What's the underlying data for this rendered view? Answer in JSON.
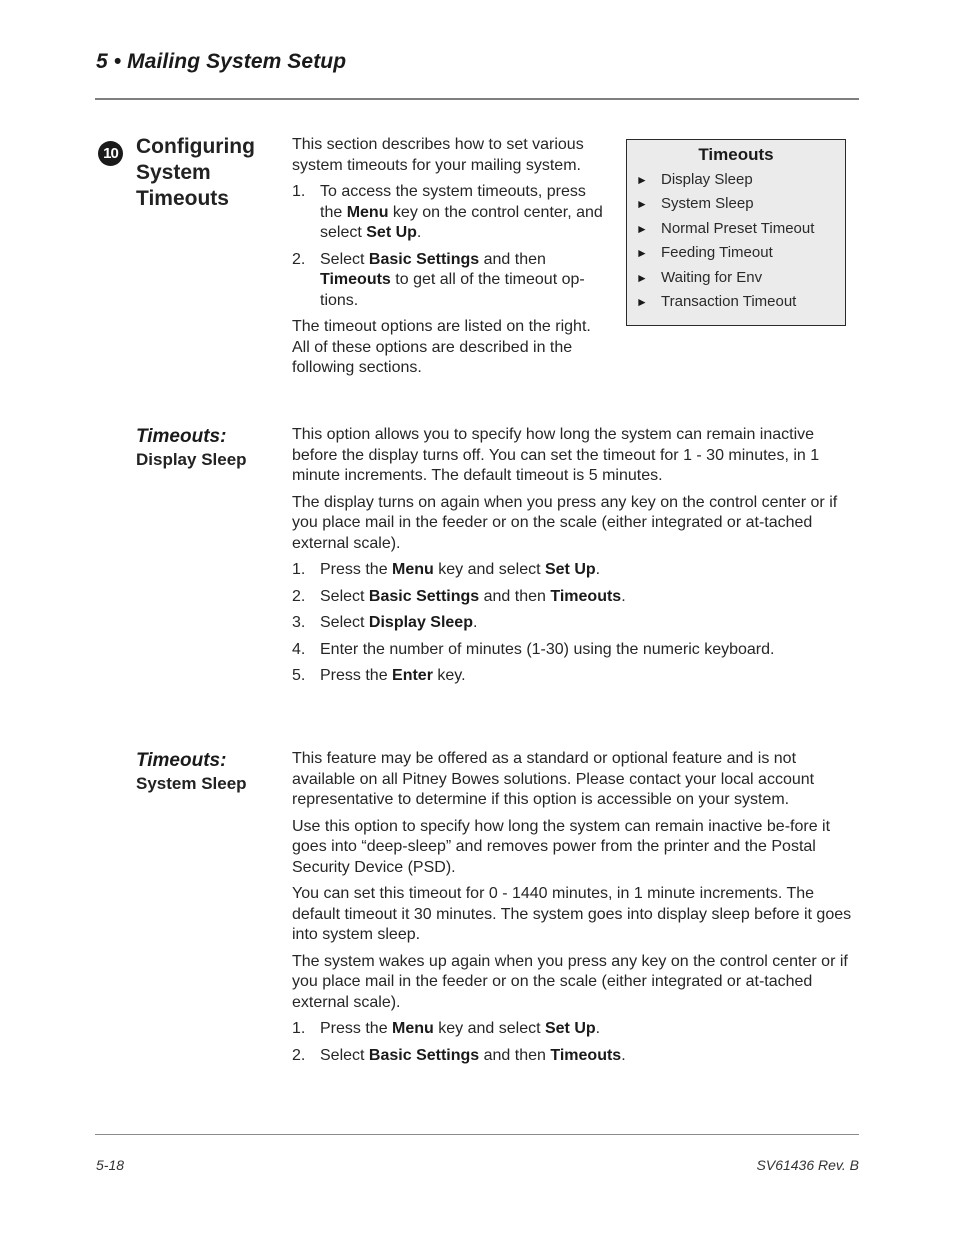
{
  "header": {
    "chapter_title": "5 • Mailing System Setup"
  },
  "section": {
    "step_number": "10",
    "heading": "Configuring System Timeouts",
    "intro_paragraph": "This section describes how to set various system timeouts for your mailing system.",
    "steps": [
      {
        "num": "1.",
        "parts": [
          {
            "t": "To access the system timeouts, press the "
          },
          {
            "b": "Menu"
          },
          {
            "t": " key on the control center, and select "
          },
          {
            "b": "Set Up"
          },
          {
            "t": "."
          }
        ]
      },
      {
        "num": "2.",
        "parts": [
          {
            "t": "Select "
          },
          {
            "b": "Basic Settings"
          },
          {
            "t": " and then "
          },
          {
            "b": "Timeouts"
          },
          {
            "t": " to get all of the timeout op-tions."
          }
        ]
      }
    ],
    "closing_paragraph": "The timeout options are listed on the right. All of these options are described in the following sections."
  },
  "timeouts_box": {
    "title": "Timeouts",
    "bullet_icon": "right-triangle",
    "items": [
      "Display Sleep",
      "System Sleep",
      "Normal Preset Timeout",
      "Feeding Timeout",
      "Waiting for Env",
      "Transaction Timeout"
    ]
  },
  "display_sleep": {
    "label_italic": "Timeouts:",
    "label_bold": "Display Sleep",
    "paragraphs": [
      "This option allows you to specify how long the system can remain inactive before the display turns off. You can set the timeout for 1 - 30 minutes, in 1 minute increments. The default timeout is 5 minutes.",
      "The display turns on again when you press any key on the control center or if you place mail in the feeder or on the scale (either integrated or at-tached external scale)."
    ],
    "steps": [
      {
        "num": "1.",
        "parts": [
          {
            "t": "Press the "
          },
          {
            "b": "Menu"
          },
          {
            "t": " key and select "
          },
          {
            "b": "Set Up"
          },
          {
            "t": "."
          }
        ]
      },
      {
        "num": "2.",
        "parts": [
          {
            "t": "Select "
          },
          {
            "b": "Basic Settings"
          },
          {
            "t": " and then "
          },
          {
            "b": "Timeouts"
          },
          {
            "t": "."
          }
        ]
      },
      {
        "num": "3.",
        "parts": [
          {
            "t": "Select "
          },
          {
            "b": "Display Sleep"
          },
          {
            "t": "."
          }
        ]
      },
      {
        "num": "4.",
        "parts": [
          {
            "t": "Enter the number of minutes (1-30) using the numeric keyboard."
          }
        ]
      },
      {
        "num": "5.",
        "parts": [
          {
            "t": "Press the "
          },
          {
            "b": "Enter"
          },
          {
            "t": " key."
          }
        ]
      }
    ]
  },
  "system_sleep": {
    "label_italic": "Timeouts:",
    "label_bold": "System Sleep",
    "paragraphs": [
      "This feature may be offered as a standard or optional feature and is not available on all Pitney Bowes solutions. Please contact your local account representative to determine if this option is accessible on your system.",
      "Use this option to specify how long the system can remain inactive be-fore it goes into “deep-sleep” and removes power from the printer and the Postal Security Device (PSD).",
      "You can set this timeout for 0 - 1440 minutes, in 1 minute increments.  The default timeout it 30 minutes. The system goes into display sleep before it goes into system sleep.",
      "The system wakes up again when you press any key on the control center or if you place mail in the feeder or on the scale (either integrated or at-tached external scale)."
    ],
    "steps": [
      {
        "num": "1.",
        "parts": [
          {
            "t": "Press the "
          },
          {
            "b": "Menu"
          },
          {
            "t": " key and select "
          },
          {
            "b": "Set Up"
          },
          {
            "t": "."
          }
        ]
      },
      {
        "num": "2.",
        "parts": [
          {
            "t": "Select "
          },
          {
            "b": "Basic Settings"
          },
          {
            "t": " and then "
          },
          {
            "b": "Timeouts"
          },
          {
            "t": "."
          }
        ]
      }
    ]
  },
  "footer": {
    "page_number": "5-18",
    "doc_id": "SV61436 Rev. B"
  }
}
